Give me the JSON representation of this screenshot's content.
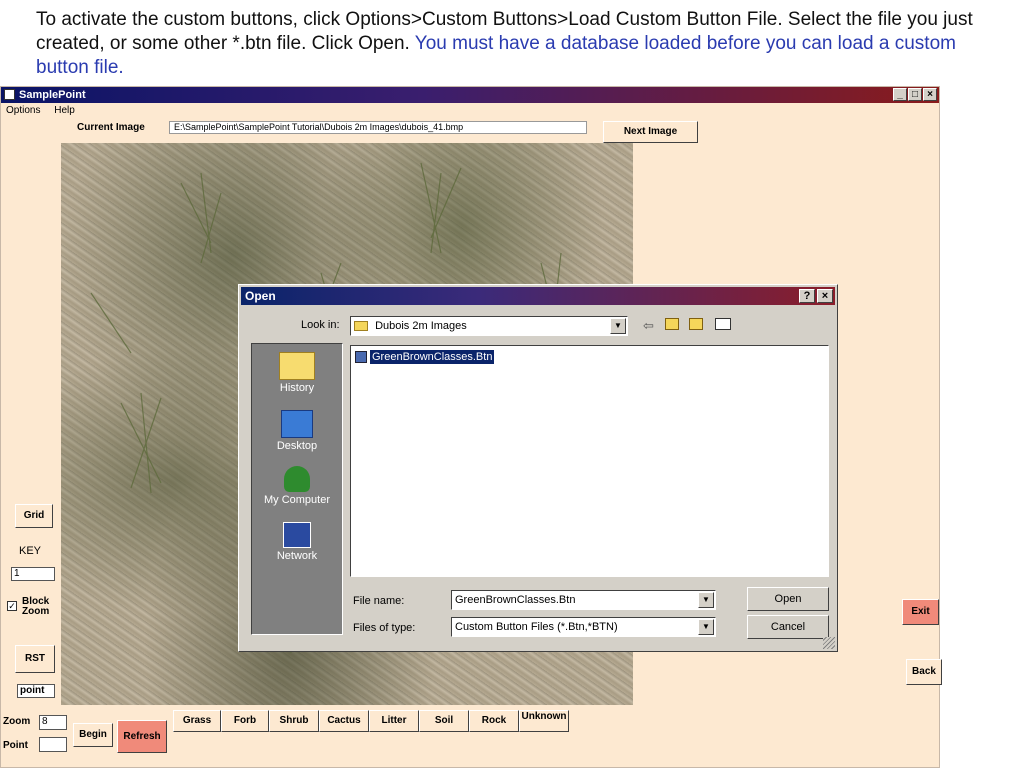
{
  "caption": {
    "text": "To activate the custom buttons, click Options>Custom Buttons>Load Custom Button File. Select the file you just created, or some other *.btn file. Click Open.",
    "highlight": "You must have a database loaded before you can load a custom button file."
  },
  "window": {
    "title": "SamplePoint",
    "menu": [
      "Options",
      "Help"
    ],
    "controls": [
      "_",
      "□",
      "×"
    ]
  },
  "header": {
    "current_image_label": "Current Image",
    "current_image_path": "E:\\SamplePoint\\SamplePoint Tutorial\\Dubois 2m Images\\dubois_41.bmp",
    "next_image_button": "Next Image"
  },
  "left_panel": {
    "grid_button": "Grid",
    "key_label": "KEY",
    "key_value": "1",
    "block_zoom_label": "Block Zoom",
    "block_zoom_checked": true,
    "rst_button": "RST",
    "point_mode": "point",
    "zoom_label": "Zoom",
    "zoom_value": "8",
    "point_label": "Point",
    "point_value": "",
    "begin_button": "Begin",
    "refresh_button": "Refresh"
  },
  "categories": [
    "Grass",
    "Forb",
    "Shrub",
    "Cactus",
    "Litter",
    "Soil",
    "Rock",
    "Unknown"
  ],
  "right_panel": {
    "exit_button": "Exit",
    "back_button": "Back"
  },
  "open_dialog": {
    "title": "Open",
    "help_button": "?",
    "close_button": "×",
    "look_in_label": "Look in:",
    "look_in_value": "Dubois 2m Images",
    "places": [
      "History",
      "Desktop",
      "My Computer",
      "Network"
    ],
    "files": [
      "GreenBrownClasses.Btn"
    ],
    "file_name_label": "File name:",
    "file_name_value": "GreenBrownClasses.Btn",
    "files_of_type_label": "Files of type:",
    "files_of_type_value": "Custom Button Files  (*.Btn,*BTN)",
    "open_button": "Open",
    "cancel_button": "Cancel"
  },
  "colors": {
    "window_bg": "#fde9d1",
    "refresh_bg": "#f08a7a",
    "exit_bg": "#f08a7a",
    "selection": "#0a246a",
    "caption_highlight": "#2a3bb0"
  }
}
